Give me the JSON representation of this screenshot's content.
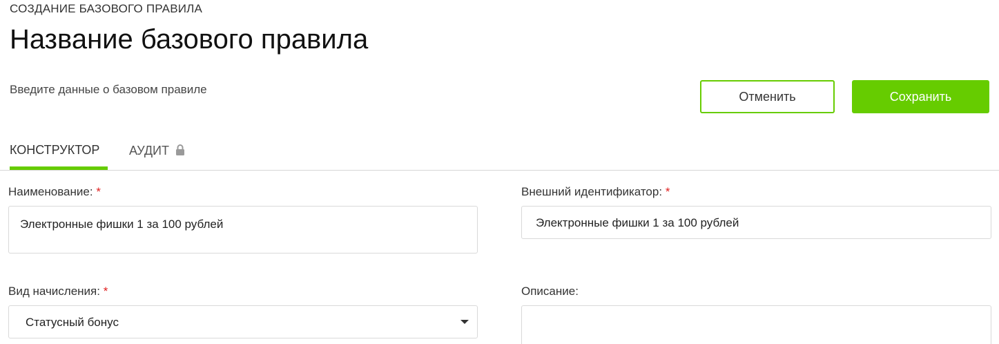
{
  "header": {
    "subtitle": "СОЗДАНИЕ БАЗОВОГО ПРАВИЛА",
    "title": "Название базового правила",
    "hint": "Введите данные о базовом правиле"
  },
  "actions": {
    "cancel_label": "Отменить",
    "save_label": "Сохранить"
  },
  "tabs": [
    {
      "label": "КОНСТРУКТОР",
      "active": true
    },
    {
      "label": "АУДИТ",
      "icon": "lock-icon",
      "active": false
    }
  ],
  "form": {
    "name": {
      "label": "Наименование:",
      "required_mark": "*",
      "value": "Электронные фишки 1 за 100 рублей"
    },
    "external_id": {
      "label": "Внешний идентификатор:",
      "required_mark": "*",
      "value": "Электронные фишки 1 за 100 рублей"
    },
    "accrual_type": {
      "label": "Вид начисления:",
      "required_mark": "*",
      "value": "Статусный бонус"
    },
    "description": {
      "label": "Описание:",
      "value": ""
    }
  },
  "colors": {
    "accent": "#66cc00",
    "required": "#e02020",
    "border": "#d9d9d9"
  }
}
